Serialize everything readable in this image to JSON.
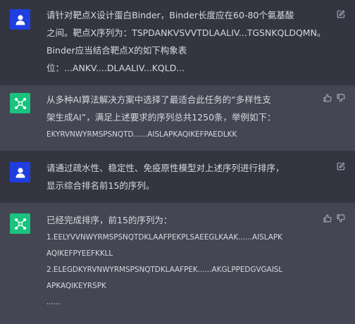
{
  "messages": [
    {
      "role": "user",
      "lines": [
        "请针对靶点X设计蛋白Binder，Binder长度应在60-80个氨基酸",
        "之间。靶点X序列为：TSPDANKVSVVTDLAALIV...TGSNKQLDQMN。",
        "Binder应当结合靶点X的如下构象表",
        "位：...ANKV....DLAALIV...KQLD..."
      ]
    },
    {
      "role": "assistant",
      "lines": [
        "从多种AI算法解决方案中选择了最适合此任务的“多样性支",
        "架生成AI”，满足上述要求的序列总共1250条，举例如下：",
        "EKYRVNWYRMSPSNQTD......AISLAPKAQIKEFPAEDLKK"
      ]
    },
    {
      "role": "user",
      "lines": [
        "请通过疏水性、稳定性、免疫原性模型对上述序列进行排序，",
        "显示综合排名前15的序列。"
      ]
    },
    {
      "role": "assistant",
      "lines": [
        "已经完成排序，前15的序列为：",
        "1.EELYVVNWYRMSPSNQTDKLAAFPEKPLSAEEGLKAAK......AISLAPK",
        "AQIKEFPYEEFKKLL",
        "2.ELEGDKYRVNWYRMSPSNQTDKLAAFPEK......AKGLPPEDGVGAISL",
        "APKAQIKEYRSPK",
        "......"
      ]
    }
  ],
  "icons": {
    "user_avatar": "user-icon",
    "assistant_avatar": "network-icon",
    "edit": "edit-icon",
    "thumbs_up": "thumbs-up-icon",
    "thumbs_down": "thumbs-down-icon"
  },
  "colors": {
    "background": "#343541",
    "assistant_background": "#444654",
    "user_avatar": "#1f3ee0",
    "assistant_avatar": "#19c37d",
    "text": "#d7d8de",
    "icon": "#acacbe"
  }
}
